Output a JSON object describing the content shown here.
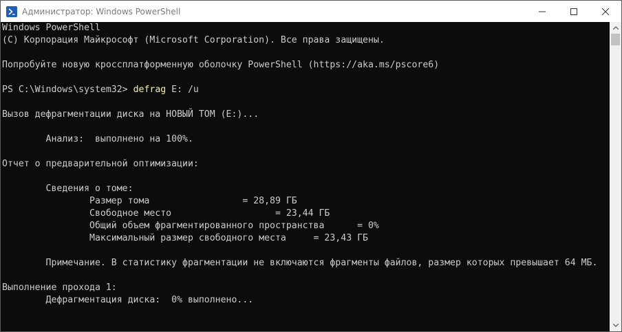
{
  "window": {
    "title": "Администратор: Windows PowerShell",
    "icon": "powershell-icon",
    "controls": [
      "minimize-icon",
      "maximize-icon",
      "close-icon"
    ]
  },
  "colors": {
    "console_background": "#0c0c0c",
    "console_text": "#cccccc",
    "command_text": "#f9f1a5",
    "titlebar_background": "#ffffff",
    "title_text": "#7a7a7a"
  },
  "console": {
    "header_line1": "Windows PowerShell",
    "header_line2": "(C) Корпорация Майкрософт (Microsoft Corporation). Все права защищены.",
    "try_pwsh": "Попробуйте новую кроссплатформенную оболочку PowerShell (https://aka.ms/pscore6)",
    "prompt": "PS C:\\Windows\\system32> ",
    "command_name": "defrag",
    "command_args": " E: /u",
    "call_line": "Вызов дефрагментации диска на НОВЫЙ ТОМ (E:)...",
    "analysis": "        Анализ:  выполнено на 100%.",
    "report_title": "Отчет о предварительной оптимизации:",
    "volume_info_title": "        Сведения о томе:",
    "volume_size": "                Размер тома                 = 28,89 ГБ",
    "free_space": "                Свободное место                   = 23,44 ГБ",
    "fragmented_space": "                Общий объем фрагментированного пространства      = 0%",
    "max_free_space": "                Максимальный размер свободного места     = 23,43 ГБ",
    "note": "        Примечание. В статистику фрагментации не включаются фрагменты файлов, размер которых превышает 64 МБ.",
    "pass_title": "Выполнение прохода 1:",
    "pass_progress": "        Дефрагментация диска:  0% выполнено..."
  }
}
